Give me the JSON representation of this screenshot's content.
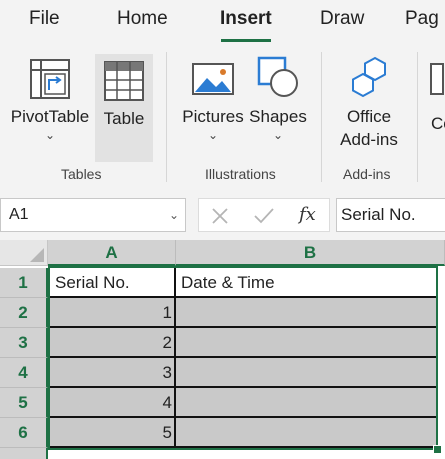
{
  "tabs": [
    {
      "label": "File"
    },
    {
      "label": "Home"
    },
    {
      "label": "Insert",
      "active": true
    },
    {
      "label": "Draw"
    },
    {
      "label": "Pag"
    }
  ],
  "ribbon": {
    "pivottable": {
      "label": "PivotTable",
      "icon": "pivottable-icon"
    },
    "table": {
      "label": "Table",
      "icon": "table-icon"
    },
    "pictures": {
      "label": "Pictures",
      "icon": "pictures-icon"
    },
    "shapes": {
      "label": "Shapes",
      "icon": "shapes-icon"
    },
    "office_addins": {
      "label_line1": "Office",
      "label_line2": "Add-ins",
      "icon": "office-addins-icon"
    },
    "cut_off": {
      "label": "Co"
    },
    "group_labels": {
      "tables": "Tables",
      "illustrations": "Illustrations",
      "addins": "Add-ins"
    },
    "chevron": "⌄"
  },
  "formula_bar": {
    "name_box": "A1",
    "fx_label": "fx",
    "formula": "Serial No."
  },
  "grid": {
    "columns": [
      "A",
      "B"
    ],
    "rows": [
      "1",
      "2",
      "3",
      "4",
      "5",
      "6"
    ],
    "cells": [
      {
        "a": "Serial No.",
        "b": "Date & Time"
      },
      {
        "a": "1",
        "b": ""
      },
      {
        "a": "2",
        "b": ""
      },
      {
        "a": "3",
        "b": ""
      },
      {
        "a": "4",
        "b": ""
      },
      {
        "a": "5",
        "b": ""
      }
    ]
  },
  "colors": {
    "accent": "#1e7145",
    "table_fill": "#c9c9c9",
    "icon_blue": "#2b7cd3"
  }
}
